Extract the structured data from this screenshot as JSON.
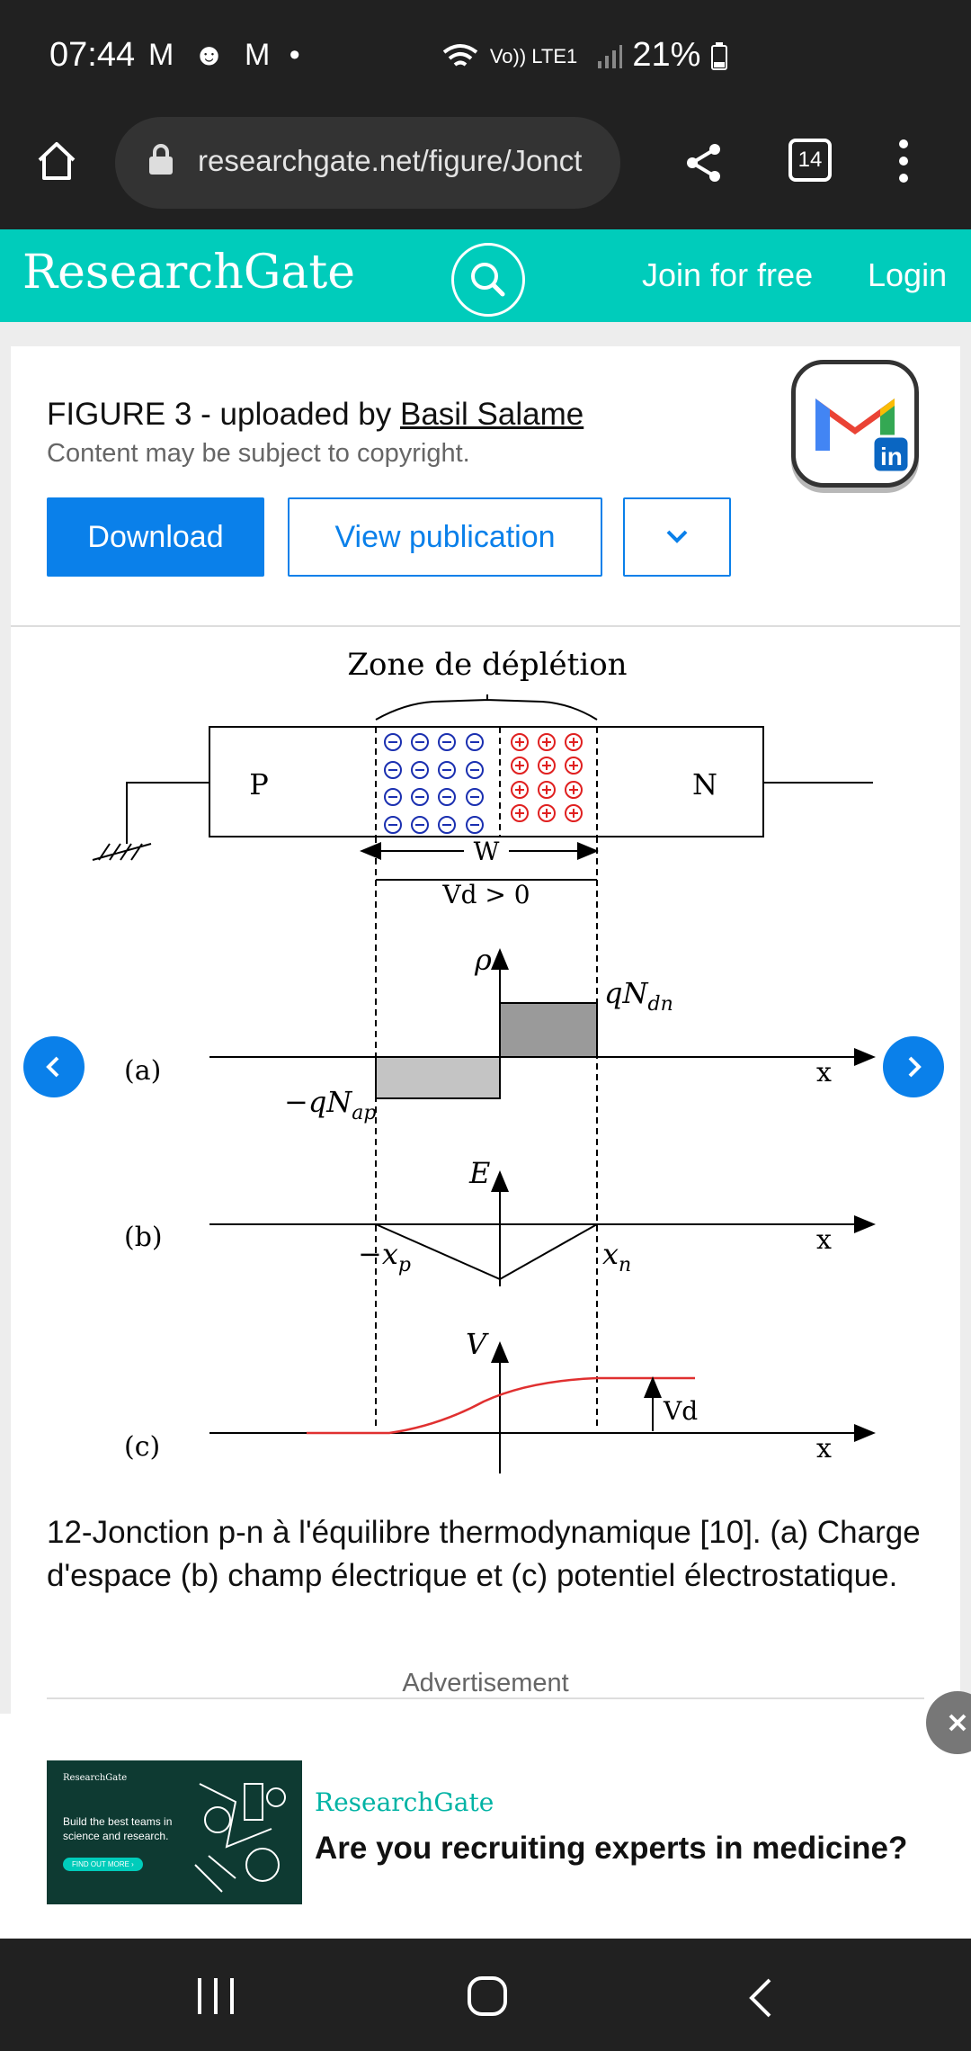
{
  "status_bar": {
    "time": "07:44",
    "notification_icons": [
      "gmail-icon",
      "messenger-icon",
      "gmail-icon",
      "dot"
    ],
    "network_label": "Vo)) LTE1",
    "battery": "21%"
  },
  "browser": {
    "url": "researchgate.net/figure/Jonct",
    "tab_count": "14"
  },
  "rg_header": {
    "logo": "ResearchGate",
    "join": "Join for free",
    "login": "Login"
  },
  "figure_card": {
    "title_prefix": "FIGURE 3 - uploaded by ",
    "author": "Basil Salame",
    "copyright": "Content may be subject to copyright.",
    "download": "Download",
    "view_publication": "View publication",
    "caption": "12-Jonction p-n à l'équilibre thermodynamique [10]. (a) Charge d'espace (b) champ électrique et (c) potentiel électrostatique."
  },
  "diagram": {
    "zone_title": "Zone de déplétion",
    "p_label": "P",
    "n_label": "N",
    "w_label": "W",
    "vd_label": "Vd > 0",
    "rho_label": "ρ",
    "qndn_label": "qN",
    "qndn_sub": "dn",
    "qnap_label": "−qN",
    "qnap_sub": "ap",
    "a_label": "(a)",
    "b_label": "(b)",
    "c_label": "(c)",
    "x_label": "x",
    "e_label": "E",
    "xp_label": "−x",
    "xp_sub": "p",
    "xn_label": "x",
    "xn_sub": "n",
    "v_label": "V",
    "vd2_label": "Vd",
    "minus_sign": "⊖",
    "plus_sign": "⊕"
  },
  "advertisement": {
    "label": "Advertisement",
    "brand": "ResearchGate",
    "headline": "Are you recruiting experts in medicine?",
    "img_brand": "ResearchGate",
    "img_text": "Build the best teams in science and research.",
    "img_cta": "FIND OUT MORE ›"
  },
  "colors": {
    "rg_teal": "#00ccbb",
    "button_blue": "#0a80ea",
    "negative_ion": "#1a2fb0",
    "positive_ion": "#e02020",
    "potential_curve": "#e03030"
  }
}
